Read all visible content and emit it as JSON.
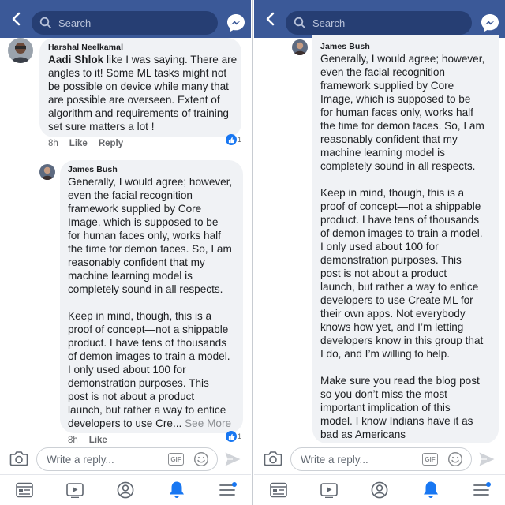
{
  "colors": {
    "header_bg": "#3b5998",
    "search_bg": "#263e73",
    "bubble_bg": "#f0f2f5",
    "accent_blue": "#1877f2",
    "meta_gray": "#65676b"
  },
  "header": {
    "search_placeholder": "Search",
    "icons": [
      "chevron-left-icon",
      "search-icon",
      "messenger-icon"
    ]
  },
  "left_pane": {
    "comment1": {
      "author": "Harshal Neelkamal",
      "mention": "Aadi Shlok",
      "text_line1_rest": " like I was saying. There are",
      "text_rest": "angles to it! Some ML tasks might not\nbe possible on device while many that\nare possible are overseen. Extent of\nalgorithm and requirements of training\nset sure matters a lot !",
      "time": "8h",
      "like_label": "Like",
      "reply_label": "Reply",
      "like_count": "1"
    },
    "comment2": {
      "author": "James Bush",
      "text": "Generally, I would agree; however,\neven the facial recognition\nframework supplied by Core\nImage, which is supposed to be\nfor human faces only, works half\nthe time for demon faces. So, I am\nreasonably confident that my\nmachine learning model is\ncompletely sound in all respects.\n\nKeep in mind, though, this is a\nproof of concept—not a shippable\nproduct. I have tens of thousands\nof demon images to train a model.\nI only used about 100 for\ndemonstration purposes. This\npost is not about a product\nlaunch, but rather a way to entice",
      "last_line": "developers to use Cre... ",
      "see_more": "See More",
      "time": "8h",
      "like_label": "Like",
      "like_count": "1"
    }
  },
  "right_pane": {
    "comment": {
      "author": "James Bush",
      "text": "Generally, I would agree; however,\neven the facial recognition\nframework supplied by Core\nImage, which is supposed to be\nfor human faces only, works half\nthe time for demon faces. So, I am\nreasonably confident that my\nmachine learning model is\ncompletely sound in all respects.\n\nKeep in mind, though, this is a\nproof of concept—not a shippable\nproduct. I have tens of thousands\nof demon images to train a model.\nI only used about 100 for\ndemonstration purposes. This\npost is not about a product\nlaunch, but rather a way to entice\ndevelopers to use Create ML for\ntheir own apps. Not everybody\nknows how yet, and I’m letting\ndevelopers know in this group that\nI do, and I’m willing to help.\n\nMake sure you read the blog post\nso you don’t miss the most\nimportant implication of this\nmodel. I know Indians have it as\nbad as Americans"
    }
  },
  "reply_bar": {
    "placeholder": "Write a reply...",
    "gif_label": "GIF",
    "icons": [
      "camera-icon",
      "gif-icon",
      "emoji-icon",
      "send-icon"
    ]
  },
  "bottom_nav": {
    "items": [
      "news-feed-icon",
      "watch-icon",
      "profile-icon",
      "notifications-bell-icon",
      "menu-icon"
    ]
  }
}
